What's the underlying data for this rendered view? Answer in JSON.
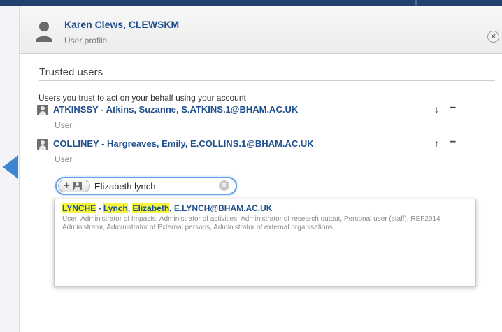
{
  "header": {
    "name": "Karen Clews, CLEWSKM",
    "subtitle": "User profile",
    "close_icon": "close-icon"
  },
  "section": {
    "title": "Trusted users",
    "description": "Users you trust to act on your behalf using your account"
  },
  "trusted_users": [
    {
      "label": "ATKINSSY - Atkins, Suzanne, S.ATKINS.1@BHAM.AC.UK",
      "role": "User",
      "move": "↓",
      "remove": "−"
    },
    {
      "label": "COLLINEY - Hargreaves, Emily, E.COLLINS.1@BHAM.AC.UK",
      "role": "User",
      "move": "↑",
      "remove": "−"
    }
  ],
  "search": {
    "value": "Elizabeth lynch",
    "add_label": "+",
    "clear_label": "×"
  },
  "result": {
    "username": "LYNCHE",
    "separator": " - ",
    "last": "Lynch",
    "comma1": ", ",
    "first": "Elizabeth",
    "email": ", E.LYNCH@BHAM.AC.UK",
    "roles": "User: Administrator of Impacts, Administrator of activities, Administrator of research output, Personal user (staff), REF2014 Administrator, Administrator of External persons, Administrator of external organisations"
  },
  "colors": {
    "topbar": "#23416e",
    "link_blue": "#1f4f8d",
    "highlight": "#f5f542",
    "focus_blue": "#5fa4e6",
    "left_tab": "#3a86d1"
  }
}
